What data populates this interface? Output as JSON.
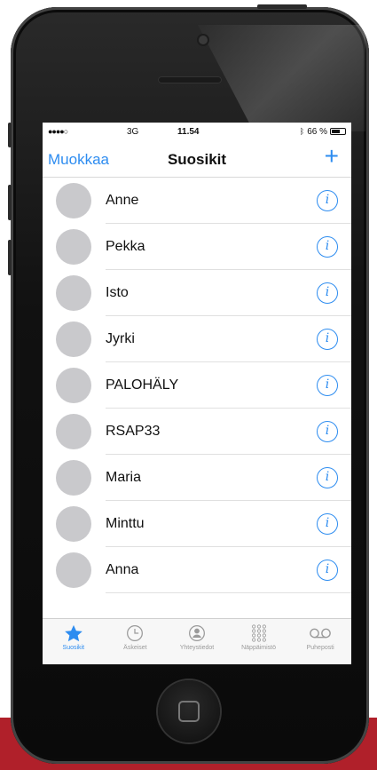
{
  "status_bar": {
    "signal": "●●●●○",
    "network": "3G",
    "time": "11.54",
    "battery_text": "66 %",
    "battery_level": 0.66
  },
  "navbar": {
    "left_label": "Muokkaa",
    "title": "Suosikit",
    "add_label": "+"
  },
  "favorites": [
    {
      "name": "Anne"
    },
    {
      "name": "Pekka"
    },
    {
      "name": "Isto"
    },
    {
      "name": "Jyrki"
    },
    {
      "name": "PALOHÄLY"
    },
    {
      "name": "RSAP33"
    },
    {
      "name": "Maria"
    },
    {
      "name": "Minttu"
    },
    {
      "name": "Anna"
    }
  ],
  "info_glyph": "i",
  "tabs": [
    {
      "label": "Suosikit",
      "icon": "star-icon",
      "active": true
    },
    {
      "label": "Äskeiset",
      "icon": "clock-icon",
      "active": false
    },
    {
      "label": "Yhteystiedot",
      "icon": "contact-icon",
      "active": false
    },
    {
      "label": "Näppäimistö",
      "icon": "keypad-icon",
      "active": false
    },
    {
      "label": "Puheposti",
      "icon": "voicemail-icon",
      "active": false
    }
  ],
  "colors": {
    "accent": "#2d8cf0",
    "avatar": "#c9c9cc",
    "background_strip": "#b0202a"
  }
}
